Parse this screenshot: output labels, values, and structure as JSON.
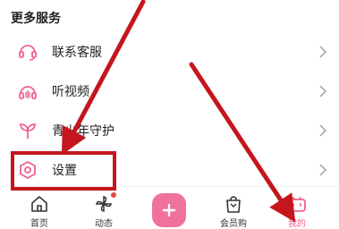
{
  "section": {
    "title": "更多服务"
  },
  "menu": [
    {
      "label": "联系客服",
      "icon": "headset-icon"
    },
    {
      "label": "听视频",
      "icon": "headphones-icon"
    },
    {
      "label": "青少年守护",
      "icon": "sprout-icon"
    },
    {
      "label": "设置",
      "icon": "settings-hexagon-icon"
    }
  ],
  "tabbar": {
    "items": [
      {
        "label": "首页",
        "icon": "home-icon"
      },
      {
        "label": "动态",
        "icon": "pinwheel-icon"
      },
      {
        "label": "",
        "icon": "plus-icon"
      },
      {
        "label": "会员购",
        "icon": "shopping-bag-icon"
      },
      {
        "label": "我的",
        "icon": "tv-mascot-icon",
        "active": true
      }
    ]
  },
  "colors": {
    "accent": "#f0618e",
    "annotation": "#c4161c",
    "plus_button": "#f0729c"
  }
}
